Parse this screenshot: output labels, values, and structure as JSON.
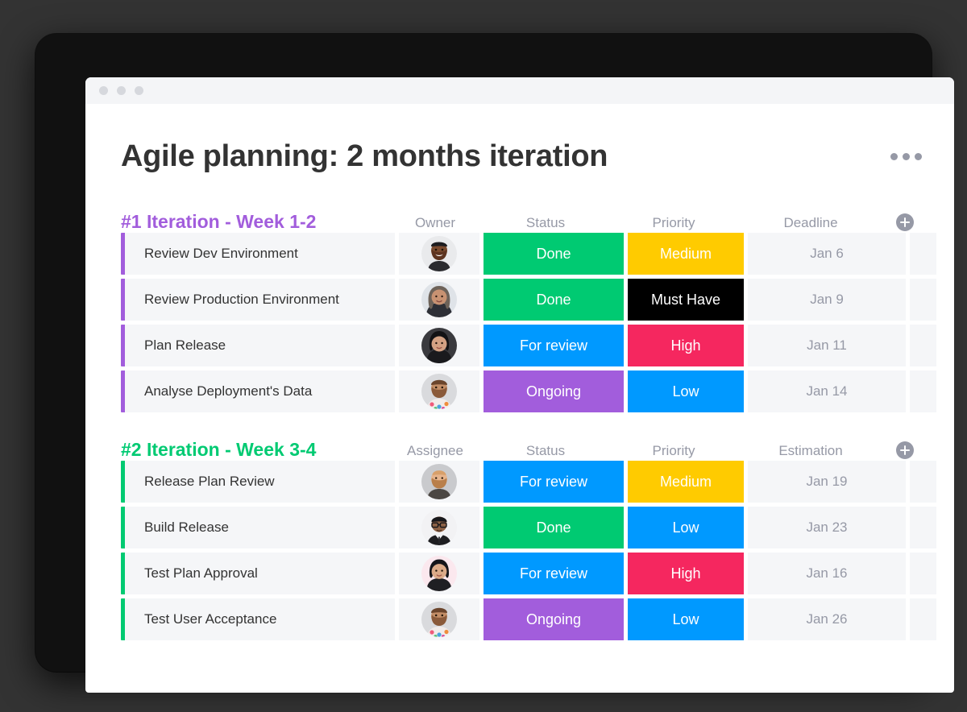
{
  "window": {
    "traffic_lights": [
      "close",
      "minimize",
      "maximize"
    ]
  },
  "header": {
    "title": "Agile planning: 2 months iteration",
    "menu_icon": "kebab-menu-icon"
  },
  "colors": {
    "green": "#00ca72",
    "blue": "#0099ff",
    "purple": "#a25ddc",
    "yellow": "#ffcb00",
    "red": "#f5275f",
    "black": "#000000",
    "cell_bg": "#f5f6f8",
    "muted_text": "#9699a6"
  },
  "groups": [
    {
      "title": "#1 Iteration - Week 1-2",
      "accent": "purple",
      "columns": [
        "Owner",
        "Status",
        "Priority",
        "Deadline"
      ],
      "add_column_label": "+",
      "rows": [
        {
          "name": "Review Dev Environment",
          "owner": "avatar-bearded-man",
          "status": {
            "label": "Done",
            "color": "#00ca72"
          },
          "priority": {
            "label": "Medium",
            "color": "#ffcb00"
          },
          "deadline": "Jan 6"
        },
        {
          "name": "Review Production Environment",
          "owner": "avatar-long-hair-woman",
          "status": {
            "label": "Done",
            "color": "#00ca72"
          },
          "priority": {
            "label": "Must Have",
            "color": "#000000"
          },
          "deadline": "Jan 9"
        },
        {
          "name": "Plan Release",
          "owner": "avatar-dark-hair-woman",
          "status": {
            "label": "For review",
            "color": "#0099ff"
          },
          "priority": {
            "label": "High",
            "color": "#f5275f"
          },
          "deadline": "Jan 11"
        },
        {
          "name": "Analyse Deployment's Data",
          "owner": "avatar-floral-shirt-man",
          "status": {
            "label": "Ongoing",
            "color": "#a25ddc"
          },
          "priority": {
            "label": "Low",
            "color": "#0099ff"
          },
          "deadline": "Jan 14"
        }
      ]
    },
    {
      "title": "#2 Iteration - Week 3-4",
      "accent": "green",
      "columns": [
        "Assignee",
        "Status",
        "Priority",
        "Estimation"
      ],
      "add_column_label": "+",
      "rows": [
        {
          "name": "Release Plan Review",
          "owner": "avatar-blond-beard-man",
          "status": {
            "label": "For review",
            "color": "#0099ff"
          },
          "priority": {
            "label": "Medium",
            "color": "#ffcb00"
          },
          "deadline": "Jan 19"
        },
        {
          "name": "Build Release",
          "owner": "avatar-suit-glasses-man",
          "status": {
            "label": "Done",
            "color": "#00ca72"
          },
          "priority": {
            "label": "Low",
            "color": "#0099ff"
          },
          "deadline": "Jan 23"
        },
        {
          "name": "Test Plan Approval",
          "owner": "avatar-dark-hair-woman-pink",
          "status": {
            "label": "For review",
            "color": "#0099ff"
          },
          "priority": {
            "label": "High",
            "color": "#f5275f"
          },
          "deadline": "Jan 16"
        },
        {
          "name": "Test User Acceptance",
          "owner": "avatar-floral-shirt-man",
          "status": {
            "label": "Ongoing",
            "color": "#a25ddc"
          },
          "priority": {
            "label": "Low",
            "color": "#0099ff"
          },
          "deadline": "Jan 26"
        }
      ]
    }
  ]
}
